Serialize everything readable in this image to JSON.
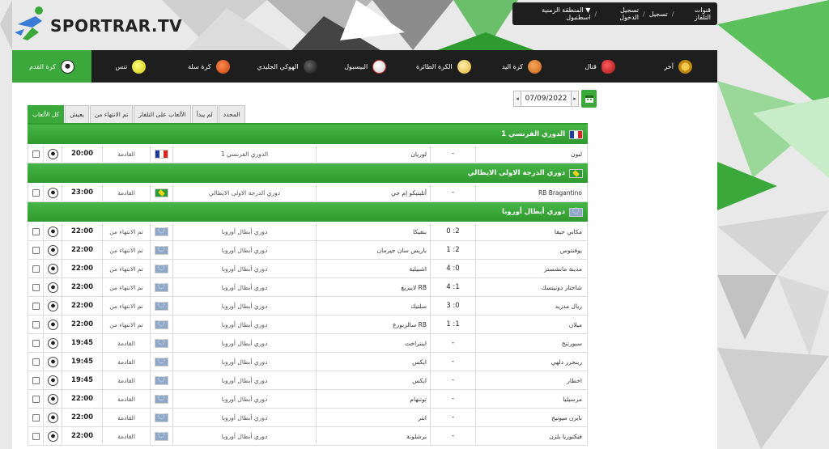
{
  "site": {
    "logo_text": "SPORTRAR.TV"
  },
  "topbar": {
    "items": [
      "قنوات التلفاز",
      "تسجيل",
      "تسجيل الدخول",
      "▼ المنطقة الزمنية اسطنبول"
    ],
    "separator": "/"
  },
  "nav": {
    "items": [
      {
        "label": "آخر",
        "icon": "trophy-icon",
        "color": "#d9a21b"
      },
      {
        "label": "قتال",
        "icon": "boxing-glove-icon",
        "color": "#cc2b2b"
      },
      {
        "label": "كرة اليد",
        "icon": "handball-icon",
        "color": "#e0802a"
      },
      {
        "label": "الكرة الطائرة",
        "icon": "volleyball-icon",
        "color": "#e8c24a"
      },
      {
        "label": "البيسبول",
        "icon": "baseball-icon",
        "color": "#eeeeee"
      },
      {
        "label": "الهوكي الجليدي",
        "icon": "hockey-puck-icon",
        "color": "#333333"
      },
      {
        "label": "كرة سلة",
        "icon": "basketball-icon",
        "color": "#e0612a"
      },
      {
        "label": "تنس",
        "icon": "tennis-ball-icon",
        "color": "#e6e02a"
      },
      {
        "label": "كرة القدم",
        "icon": "soccer-ball-icon",
        "color": "#ffffff",
        "active": true
      }
    ]
  },
  "date": {
    "value": "07/09/2022",
    "prev": "◂",
    "next": "▸"
  },
  "tabs": [
    {
      "label": "كل الألعاب",
      "active": true
    },
    {
      "label": "يعيش"
    },
    {
      "label": "تم الانتهاء من"
    },
    {
      "label": "الألعاب على التلفاز"
    },
    {
      "label": "لم يبدأ"
    },
    {
      "label": "المحدد"
    }
  ],
  "leagues": [
    {
      "name": "الدوري الفرنسي 1",
      "flag": "fr",
      "matches": [
        {
          "home": "ليون",
          "score": "-",
          "away": "لوريان",
          "competition": "الدوري الفرنسي 1",
          "status": "القادمة",
          "time": "20:00"
        }
      ]
    },
    {
      "name": "دوري الدرجة الاولى الايطالي",
      "flag": "br",
      "matches": [
        {
          "home": "RB Bragantino",
          "score": "-",
          "away": "أتليتيكو إم جي",
          "competition": "دوري الدرجة الاولى الايطالي",
          "status": "القادمة",
          "time": "23:00"
        }
      ]
    },
    {
      "name": "دوري أبطال أوروبا",
      "flag": "eu",
      "matches": [
        {
          "home": "مكابي حيفا",
          "score": "0 :2",
          "away": "بنفيكا",
          "competition": "دوري أبطال أوروبا",
          "status": "تم الانتهاء من",
          "time": "22:00"
        },
        {
          "home": "يوفنتوس",
          "score": "1 :2",
          "away": "باريس سان جيرمان",
          "competition": "دوري أبطال أوروبا",
          "status": "تم الانتهاء من",
          "time": "22:00"
        },
        {
          "home": "مدينة مانشستر",
          "score": "4 :0",
          "away": "اشبيلية",
          "competition": "دوري أبطال أوروبا",
          "status": "تم الانتهاء من",
          "time": "22:00"
        },
        {
          "home": "شاختار دونيتسك",
          "score": "4 :1",
          "away": "لايبزيغ RB",
          "competition": "دوري أبطال أوروبا",
          "status": "تم الانتهاء من",
          "time": "22:00"
        },
        {
          "home": "ريال مدريد",
          "score": "3 :0",
          "away": "سلتيك",
          "competition": "دوري أبطال أوروبا",
          "status": "تم الانتهاء من",
          "time": "22:00"
        },
        {
          "home": "ميلان",
          "score": "1 :1",
          "away": "سالزبورغ RB",
          "competition": "دوري أبطال أوروبا",
          "status": "تم الانتهاء من",
          "time": "22:00"
        },
        {
          "home": "سبورتنج",
          "score": "-",
          "away": "اينتراخت",
          "competition": "دوري أبطال أوروبا",
          "status": "القادمة",
          "time": "19:45"
        },
        {
          "home": "رينجرز دلهي",
          "score": "-",
          "away": "ايكس",
          "competition": "دوري أبطال أوروبا",
          "status": "القادمة",
          "time": "19:45"
        },
        {
          "home": "اخطار",
          "score": "-",
          "away": "ايكس",
          "competition": "دوري أبطال أوروبا",
          "status": "القادمة",
          "time": "19:45"
        },
        {
          "home": "مرسيليا",
          "score": "-",
          "away": "توتنهام",
          "competition": "دوري أبطال أوروبا",
          "status": "القادمة",
          "time": "22:00"
        },
        {
          "home": "بايرن ميونيخ",
          "score": "-",
          "away": "انتر",
          "competition": "دوري أبطال أوروبا",
          "status": "القادمة",
          "time": "22:00"
        },
        {
          "home": "فيكتوريا بلزن",
          "score": "-",
          "away": "برشلونة",
          "competition": "دوري أبطال أوروبا",
          "status": "القادمة",
          "time": "22:00"
        }
      ]
    }
  ]
}
